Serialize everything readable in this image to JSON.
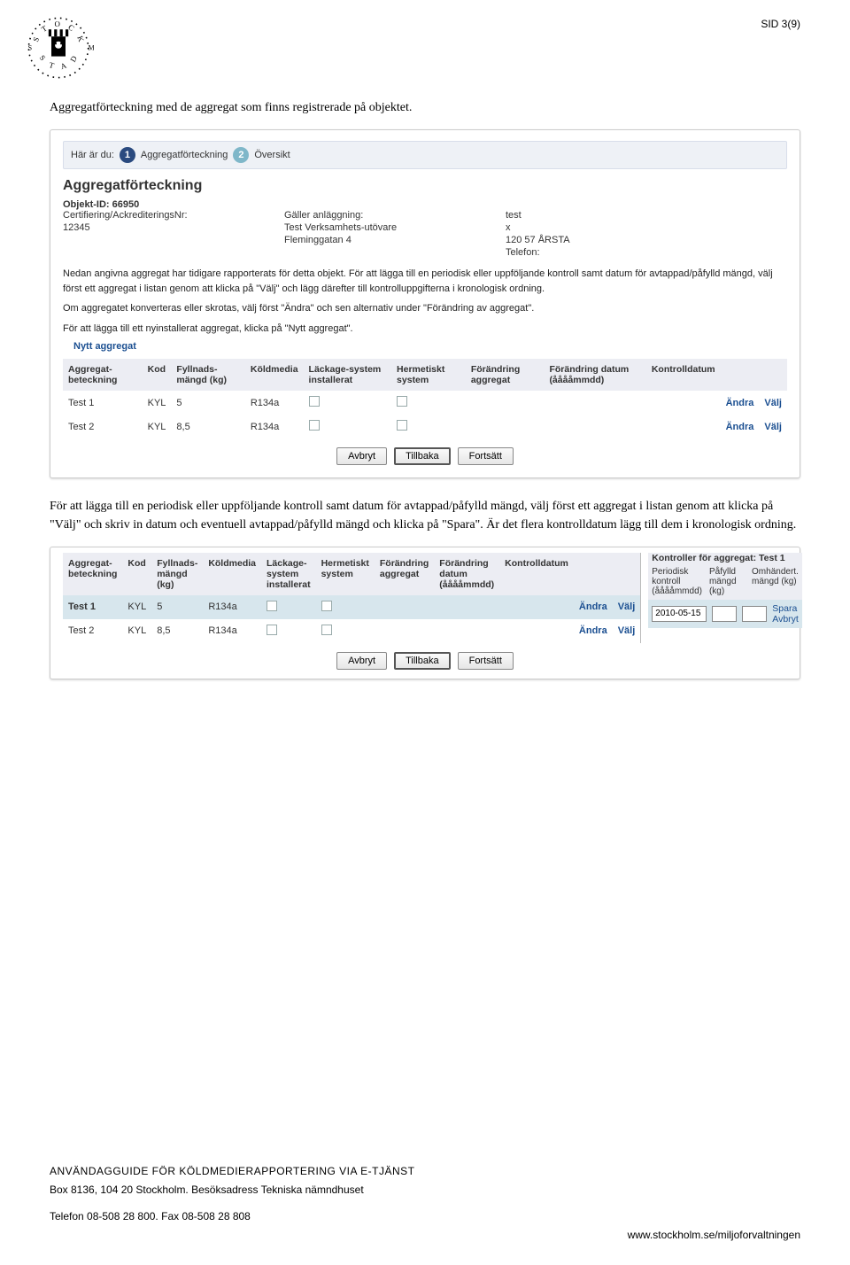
{
  "page_num": "SID 3(9)",
  "intro_text": "Aggregatförteckning med de aggregat som finns registrerade på objektet.",
  "second_text": "För att lägga till en periodisk eller uppföljande kontroll samt datum för avtappad/påfylld mängd, välj först ett aggregat i listan genom att klicka på \"Välj\" och skriv in datum och eventuell avtappad/påfylld mängd och klicka på \"Spara\". Är det flera kontrolldatum lägg till dem i kronologisk ordning.",
  "breadcrumb": {
    "label": "Här är du:",
    "step1_num": "1",
    "step1_label": "Aggregatförteckning",
    "step2_num": "2",
    "step2_label": "Översikt",
    "colors": {
      "active": "#2a4a7f",
      "inactive": "#7fb7c9"
    }
  },
  "panel1": {
    "title": "Aggregatförteckning",
    "object_label": "Objekt-ID: 66950",
    "cert_label": "Certifiering/AckrediteringsNr:",
    "cert_value": "12345",
    "col2_label1": "Gäller anläggning:",
    "col2_value1": "Test Verksamhets-utövare",
    "col2_value2": "Fleminggatan 4",
    "col3_value1": "test",
    "col3_value2": "x",
    "col3_value3": "120 57   ÅRSTA",
    "col3_value4": "Telefon:",
    "help1": "Nedan angivna aggregat har tidigare rapporterats för detta objekt. För att lägga till en periodisk eller uppföljande kontroll samt datum för avtappad/påfylld mängd, välj först ett aggregat i listan genom att klicka på \"Välj\" och lägg därefter till kontrolluppgifterna i kronologisk ordning.",
    "help2": "Om aggregatet konverteras eller skrotas, välj först \"Ändra\" och sen alternativ under \"Förändring av aggregat\".",
    "help3": "För att lägga till ett nyinstallerat aggregat, klicka på \"Nytt aggregat\".",
    "new_aggregate": "Nytt aggregat",
    "headers": {
      "h1": "Aggregat-beteckning",
      "h2": "Kod",
      "h3": "Fyllnads-mängd (kg)",
      "h4": "Köldmedia",
      "h5": "Läckage-system installerat",
      "h6": "Hermetiskt system",
      "h7": "Förändring aggregat",
      "h8": "Förändring datum (ååååmmdd)",
      "h9": "Kontrolldatum"
    },
    "rows": [
      {
        "name": "Test 1",
        "kod": "KYL",
        "mangd": "5",
        "media": "R134a",
        "edit": "Ändra",
        "choose": "Välj"
      },
      {
        "name": "Test 2",
        "kod": "KYL",
        "mangd": "8,5",
        "media": "R134a",
        "edit": "Ändra",
        "choose": "Välj"
      }
    ],
    "buttons": {
      "cancel": "Avbryt",
      "back": "Tillbaka",
      "next": "Fortsätt"
    }
  },
  "panel2": {
    "headers": {
      "h1": "Aggregat-beteckning",
      "h2": "Kod",
      "h3": "Fyllnads-mängd (kg)",
      "h4": "Köldmedia",
      "h5": "Läckage-system installerat",
      "h6": "Hermetiskt system",
      "h7": "Förändring aggregat",
      "h8": "Förändring datum (ååååmmdd)",
      "h9": "Kontrolldatum"
    },
    "side": {
      "title": "Kontroller för aggregat: Test 1",
      "c1": "Periodisk kontroll (ååååmmdd)",
      "c2": "Påfylld mängd (kg)",
      "c3": "Omhändert. mängd (kg)",
      "date": "2010-05-15",
      "save": "Spara",
      "cancel": "Avbryt"
    },
    "rows": [
      {
        "name": "Test 1",
        "kod": "KYL",
        "mangd": "5",
        "media": "R134a",
        "edit": "Ändra",
        "choose": "Välj",
        "selected": true
      },
      {
        "name": "Test 2",
        "kod": "KYL",
        "mangd": "8,5",
        "media": "R134a",
        "edit": "Ändra",
        "choose": "Välj"
      }
    ],
    "buttons": {
      "cancel": "Avbryt",
      "back": "Tillbaka",
      "next": "Fortsätt"
    }
  },
  "footer": {
    "l1": "ANVÄNDAGGUIDE FÖR KÖLDMEDIERAPPORTERING VIA E-TJÄNST",
    "l2a": "Box 8136, 104 20 Stockholm. ",
    "l2b": "Besöksadress Tekniska nämndhuset",
    "l3a": "Telefon 08-508 28 800. ",
    "l3b": "Fax 08-508 28 808",
    "url": "www.stockholm.se/miljoforvaltningen"
  }
}
